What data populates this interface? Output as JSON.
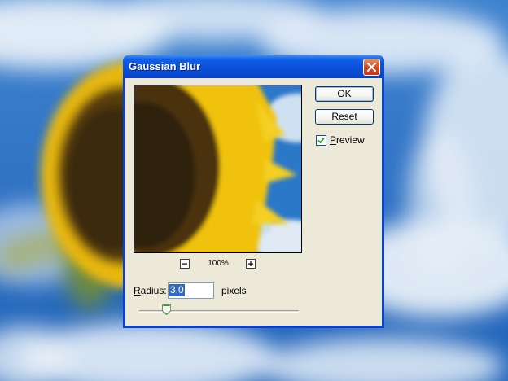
{
  "window": {
    "title": "Gaussian Blur"
  },
  "preview": {
    "zoom_level": "100%"
  },
  "buttons": {
    "ok_label": "OK",
    "reset_label": "Reset"
  },
  "preview_toggle": {
    "label_prefix": "",
    "label_underlined": "P",
    "label_rest": "review",
    "checked": true
  },
  "radius": {
    "label_underlined": "R",
    "label_rest": "adius:",
    "value": "3,0",
    "unit": "pixels",
    "slider_fraction": 0.17
  },
  "icons": {
    "close": "close-icon",
    "zoom_out": "minus-icon",
    "zoom_in": "plus-icon",
    "check": "checkmark-icon"
  },
  "colors": {
    "titlebar": "#0a4fd9",
    "close_button": "#d6451f",
    "dialog_face": "#ece9d8",
    "selection": "#316ac5",
    "sky": "#2a6fc2",
    "petal": "#f2c80a"
  }
}
